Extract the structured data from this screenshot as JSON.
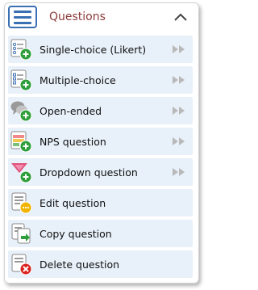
{
  "header": {
    "title": "Questions",
    "icon": "list-icon",
    "toggle_icon": "chevron-up-icon"
  },
  "colors": {
    "accent": "#3b6fb3",
    "title": "#8b3a3a",
    "item_bg": "#e8f0f9",
    "add_badge": "#2e9e3a",
    "edit_badge": "#f0b400",
    "delete_badge": "#d9231f",
    "arrow": "#b9b9b9"
  },
  "items": [
    {
      "label": "Single-choice (Likert)",
      "icon": "likert-add-icon",
      "submenu_icon": "double-arrow-right-icon"
    },
    {
      "label": "Multiple-choice",
      "icon": "multiple-choice-add-icon",
      "submenu_icon": "double-arrow-right-icon"
    },
    {
      "label": "Open-ended",
      "icon": "speech-bubbles-add-icon",
      "submenu_icon": "double-arrow-right-icon"
    },
    {
      "label": "NPS question",
      "icon": "nps-add-icon",
      "submenu_icon": "double-arrow-right-icon"
    },
    {
      "label": "Dropdown question",
      "icon": "dropdown-add-icon",
      "submenu_icon": "double-arrow-right-icon"
    },
    {
      "label": "Edit question",
      "icon": "edit-question-icon"
    },
    {
      "label": "Copy question",
      "icon": "copy-question-icon"
    },
    {
      "label": "Delete question",
      "icon": "delete-question-icon"
    }
  ]
}
